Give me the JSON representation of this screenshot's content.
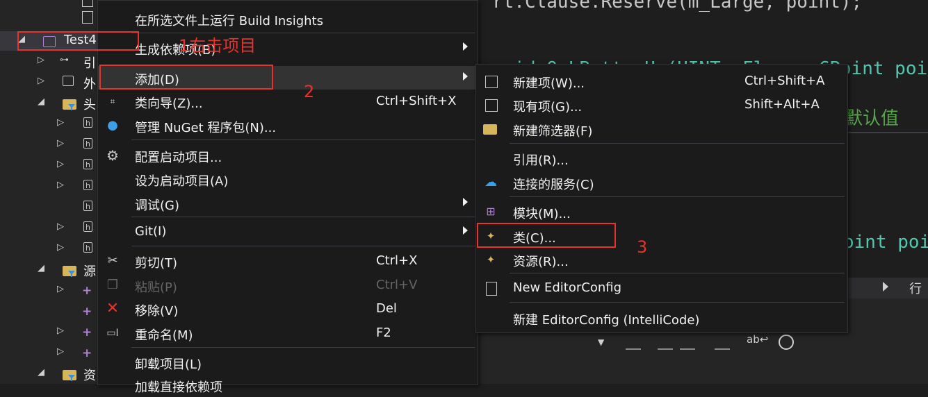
{
  "explorer": {
    "project_name": "Test4",
    "rows": [
      {
        "label": "引"
      },
      {
        "label": "外"
      },
      {
        "label": "头"
      },
      {
        "label": "源"
      },
      {
        "label": "资"
      }
    ]
  },
  "editor": {
    "line1": "rt.Clause.Reserve(m_Large, point);",
    "line2": "void OnLButtonUp(UINT nFlags, CPoint point",
    "line3": "默认值",
    "line4": "oint poi",
    "status_text": "行"
  },
  "context_menu": {
    "items": [
      {
        "label": "在所选文件上运行 Build Insights",
        "shortcut": ""
      },
      {
        "label": "生成依赖项(B)",
        "shortcut": ""
      },
      {
        "label": "添加(D)",
        "shortcut": ""
      },
      {
        "label": "类向导(Z)...",
        "shortcut": "Ctrl+Shift+X"
      },
      {
        "label": "管理 NuGet 程序包(N)...",
        "shortcut": ""
      },
      {
        "label": "配置启动项目...",
        "shortcut": ""
      },
      {
        "label": "设为启动项目(A)",
        "shortcut": ""
      },
      {
        "label": "调试(G)",
        "shortcut": ""
      },
      {
        "label": "Git(I)",
        "shortcut": ""
      },
      {
        "label": "剪切(T)",
        "shortcut": "Ctrl+X"
      },
      {
        "label": "粘贴(P)",
        "shortcut": "Ctrl+V"
      },
      {
        "label": "移除(V)",
        "shortcut": "Del"
      },
      {
        "label": "重命名(M)",
        "shortcut": "F2"
      },
      {
        "label": "卸载项目(L)",
        "shortcut": ""
      },
      {
        "label": "加载直接依赖项",
        "shortcut": ""
      }
    ]
  },
  "add_submenu": {
    "items": [
      {
        "label": "新建项(W)...",
        "shortcut": "Ctrl+Shift+A"
      },
      {
        "label": "现有项(G)...",
        "shortcut": "Shift+Alt+A"
      },
      {
        "label": "新建筛选器(F)",
        "shortcut": ""
      },
      {
        "label": "引用(R)...",
        "shortcut": ""
      },
      {
        "label": "连接的服务(C)",
        "shortcut": ""
      },
      {
        "label": "模块(M)...",
        "shortcut": ""
      },
      {
        "label": "类(C)...",
        "shortcut": ""
      },
      {
        "label": "资源(R)...",
        "shortcut": ""
      },
      {
        "label": "New EditorConfig",
        "shortcut": ""
      },
      {
        "label": "新建 EditorConfig (IntelliCode)",
        "shortcut": ""
      }
    ]
  },
  "annotations": {
    "step1": "1右击项目",
    "step2": "2",
    "step3": "3"
  },
  "colors": {
    "annotation_red": "#e8322c",
    "menu_bg": "#1b1b1c",
    "highlight": "#333334",
    "code_green": "#57a64a",
    "accent_purple": "#b180d7"
  }
}
